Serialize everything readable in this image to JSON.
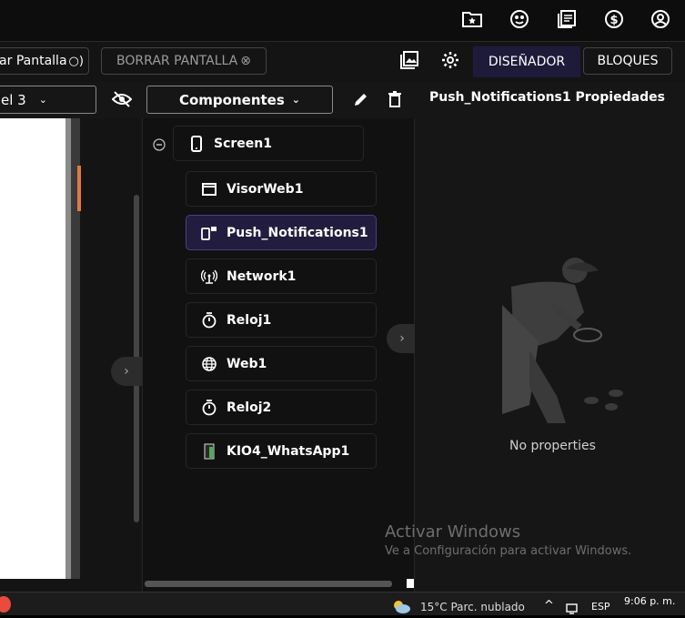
{
  "topbar": {
    "icons": [
      "folder-star-icon",
      "face-icon",
      "book-icon",
      "dollar-icon",
      "account-icon"
    ]
  },
  "toolbar": {
    "show_screen_label": "ar Pantalla",
    "clear_screen_label": "BORRAR PANTALLA",
    "designer_label": "DISEÑADOR",
    "blocks_label": "BLOQUES"
  },
  "row3": {
    "level_dropdown": "el 3",
    "components_dropdown": "Componentes"
  },
  "tree": {
    "root": "Screen1",
    "items": [
      {
        "label": "VisorWeb1",
        "icon": "window-icon"
      },
      {
        "label": "Push_Notifications1",
        "icon": "push-icon",
        "selected": true
      },
      {
        "label": "Network1",
        "icon": "antenna-icon"
      },
      {
        "label": "Reloj1",
        "icon": "timer-icon"
      },
      {
        "label": "Web1",
        "icon": "globe-icon"
      },
      {
        "label": "Reloj2",
        "icon": "timer-icon"
      },
      {
        "label": "KIO4_WhatsApp1",
        "icon": "ext-icon"
      }
    ]
  },
  "properties": {
    "title": "Push_Notifications1 Propiedades",
    "empty_text": "No properties"
  },
  "watermark": {
    "line1": "Activar Windows",
    "line2": "Ve a Configuración para activar Windows."
  },
  "taskbar": {
    "weather": "15°C  Parc. nublado",
    "language": "ESP",
    "time": "9:06 p. m."
  },
  "colors": {
    "selected_bg": "#221c3e",
    "accent_orange": "#e07a40"
  }
}
